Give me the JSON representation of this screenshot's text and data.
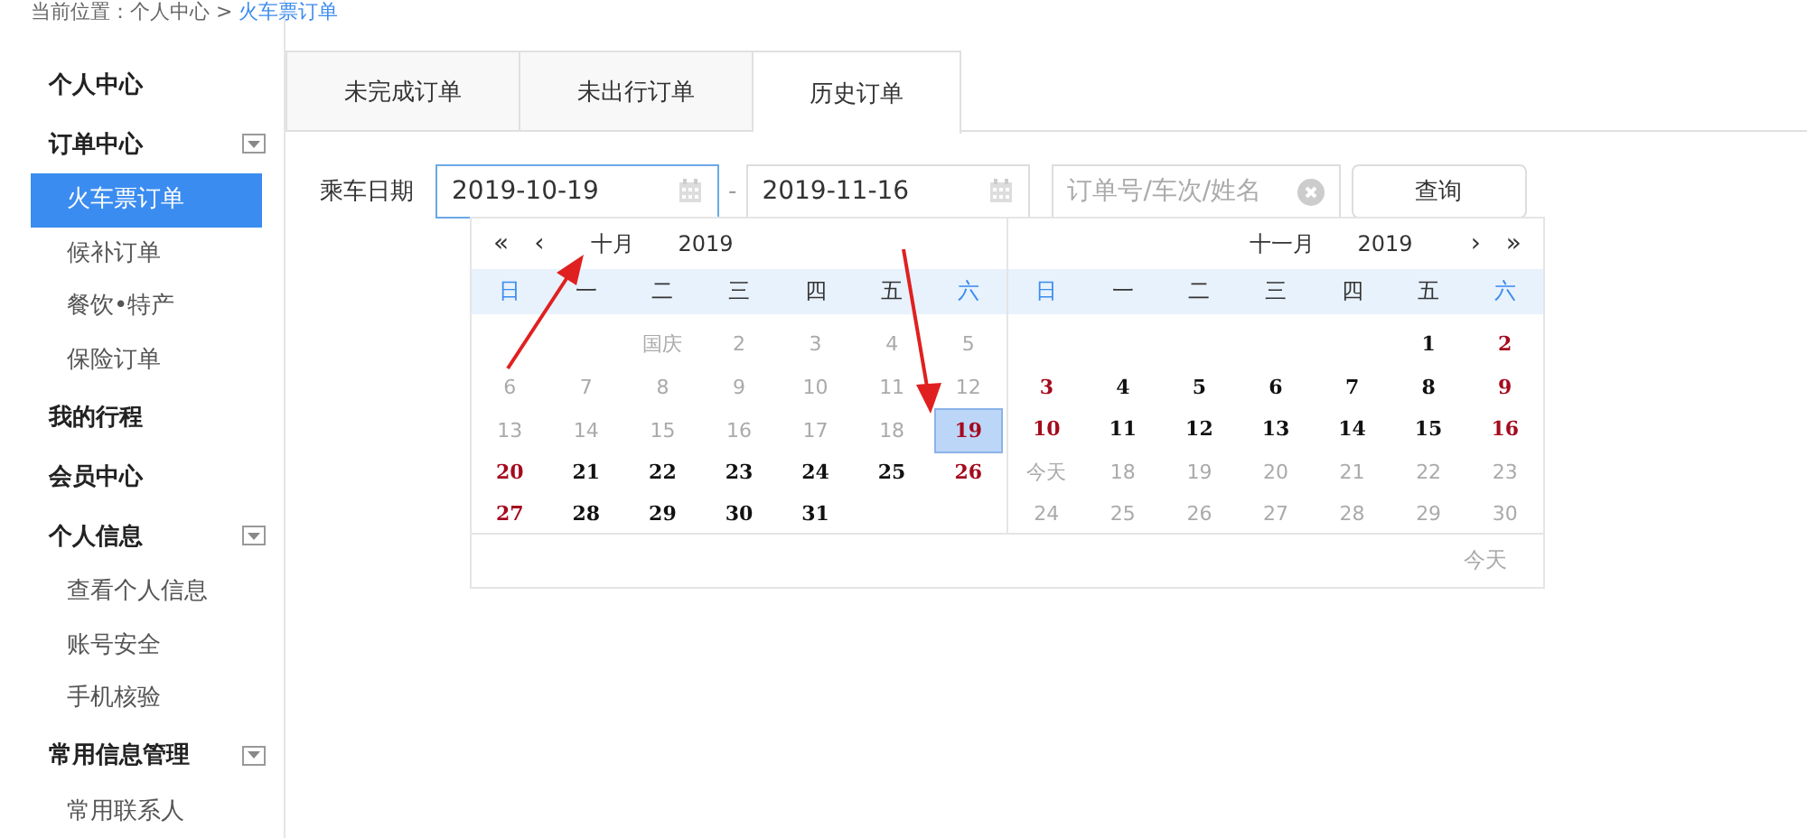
{
  "breadcrumb": {
    "prefix": "当前位置：个人中心 > ",
    "current": "火车票订单"
  },
  "sidebar": {
    "groups": [
      {
        "label": "个人中心",
        "collapsible": false
      },
      {
        "label": "订单中心",
        "collapsible": true,
        "items": [
          {
            "label": "火车票订单",
            "selected": true
          },
          {
            "label": "候补订单",
            "selected": false
          },
          {
            "label": "餐饮•特产",
            "selected": false
          },
          {
            "label": "保险订单",
            "selected": false
          }
        ]
      },
      {
        "label": "我的行程",
        "collapsible": false
      },
      {
        "label": "会员中心",
        "collapsible": false
      },
      {
        "label": "个人信息",
        "collapsible": true,
        "items": [
          {
            "label": "查看个人信息",
            "selected": false
          },
          {
            "label": "账号安全",
            "selected": false
          },
          {
            "label": "手机核验",
            "selected": false
          }
        ]
      },
      {
        "label": "常用信息管理",
        "collapsible": true,
        "items": [
          {
            "label": "常用联系人",
            "selected": false
          }
        ]
      }
    ]
  },
  "tabs": [
    {
      "label": "未完成订单",
      "selected": false
    },
    {
      "label": "未出行订单",
      "selected": false
    },
    {
      "label": "历史订单",
      "selected": true
    }
  ],
  "filter": {
    "label": "乘车日期",
    "start": "2019-10-19",
    "separator": "-",
    "end": "2019-11-16",
    "search_placeholder": "订单号/车次/姓名",
    "button": "查询"
  },
  "calendar": {
    "today_button": "今天",
    "months": [
      {
        "prev_year": "«",
        "prev_month": "‹",
        "month": "十月",
        "year": "2019",
        "weekdays": [
          {
            "label": "日",
            "weekend": true
          },
          {
            "label": "一",
            "weekend": false
          },
          {
            "label": "二",
            "weekend": false
          },
          {
            "label": "三",
            "weekend": false
          },
          {
            "label": "四",
            "weekend": false
          },
          {
            "label": "五",
            "weekend": false
          },
          {
            "label": "六",
            "weekend": true
          }
        ],
        "weeks": [
          [
            {
              "kind": "blank"
            },
            {
              "kind": "blank"
            },
            {
              "label": "国庆",
              "kind": "muted",
              "selected": false
            },
            {
              "label": "2",
              "kind": "muted",
              "selected": false
            },
            {
              "label": "3",
              "kind": "muted",
              "selected": false
            },
            {
              "label": "4",
              "kind": "muted",
              "selected": false
            },
            {
              "label": "5",
              "kind": "muted",
              "selected": false
            }
          ],
          [
            {
              "label": "6",
              "kind": "muted",
              "selected": false
            },
            {
              "label": "7",
              "kind": "muted",
              "selected": false
            },
            {
              "label": "8",
              "kind": "muted",
              "selected": false
            },
            {
              "label": "9",
              "kind": "muted",
              "selected": false
            },
            {
              "label": "10",
              "kind": "muted",
              "selected": false
            },
            {
              "label": "11",
              "kind": "muted",
              "selected": false
            },
            {
              "label": "12",
              "kind": "muted",
              "selected": false
            }
          ],
          [
            {
              "label": "13",
              "kind": "muted",
              "selected": false
            },
            {
              "label": "14",
              "kind": "muted",
              "selected": false
            },
            {
              "label": "15",
              "kind": "muted",
              "selected": false
            },
            {
              "label": "16",
              "kind": "muted",
              "selected": false
            },
            {
              "label": "17",
              "kind": "muted",
              "selected": false
            },
            {
              "label": "18",
              "kind": "muted",
              "selected": false
            },
            {
              "label": "19",
              "kind": "red",
              "selected": true
            }
          ],
          [
            {
              "label": "20",
              "kind": "red",
              "selected": false
            },
            {
              "label": "21",
              "kind": "normal",
              "selected": false
            },
            {
              "label": "22",
              "kind": "normal",
              "selected": false
            },
            {
              "label": "23",
              "kind": "normal",
              "selected": false
            },
            {
              "label": "24",
              "kind": "normal",
              "selected": false
            },
            {
              "label": "25",
              "kind": "normal",
              "selected": false
            },
            {
              "label": "26",
              "kind": "red",
              "selected": false
            }
          ],
          [
            {
              "label": "27",
              "kind": "red",
              "selected": false
            },
            {
              "label": "28",
              "kind": "normal",
              "selected": false
            },
            {
              "label": "29",
              "kind": "normal",
              "selected": false
            },
            {
              "label": "30",
              "kind": "normal",
              "selected": false
            },
            {
              "label": "31",
              "kind": "normal",
              "selected": false
            },
            {
              "kind": "blank"
            },
            {
              "kind": "blank"
            }
          ]
        ]
      },
      {
        "month": "十一月",
        "year": "2019",
        "next_month": "›",
        "next_year": "»",
        "weekdays": [
          {
            "label": "日",
            "weekend": true
          },
          {
            "label": "一",
            "weekend": false
          },
          {
            "label": "二",
            "weekend": false
          },
          {
            "label": "三",
            "weekend": false
          },
          {
            "label": "四",
            "weekend": false
          },
          {
            "label": "五",
            "weekend": false
          },
          {
            "label": "六",
            "weekend": true
          }
        ],
        "weeks": [
          [
            {
              "kind": "blank"
            },
            {
              "kind": "blank"
            },
            {
              "kind": "blank"
            },
            {
              "kind": "blank"
            },
            {
              "kind": "blank"
            },
            {
              "label": "1",
              "kind": "normal",
              "selected": false
            },
            {
              "label": "2",
              "kind": "red",
              "selected": false
            }
          ],
          [
            {
              "label": "3",
              "kind": "red",
              "selected": false
            },
            {
              "label": "4",
              "kind": "normal",
              "selected": false
            },
            {
              "label": "5",
              "kind": "normal",
              "selected": false
            },
            {
              "label": "6",
              "kind": "normal",
              "selected": false
            },
            {
              "label": "7",
              "kind": "normal",
              "selected": false
            },
            {
              "label": "8",
              "kind": "normal",
              "selected": false
            },
            {
              "label": "9",
              "kind": "red",
              "selected": false
            }
          ],
          [
            {
              "label": "10",
              "kind": "red",
              "selected": false
            },
            {
              "label": "11",
              "kind": "normal",
              "selected": false
            },
            {
              "label": "12",
              "kind": "normal",
              "selected": false
            },
            {
              "label": "13",
              "kind": "normal",
              "selected": false
            },
            {
              "label": "14",
              "kind": "normal",
              "selected": false
            },
            {
              "label": "15",
              "kind": "normal",
              "selected": false
            },
            {
              "label": "16",
              "kind": "red",
              "selected": false
            }
          ],
          [
            {
              "label": "今天",
              "kind": "muted",
              "selected": false
            },
            {
              "label": "18",
              "kind": "muted",
              "selected": false
            },
            {
              "label": "19",
              "kind": "muted",
              "selected": false
            },
            {
              "label": "20",
              "kind": "muted",
              "selected": false
            },
            {
              "label": "21",
              "kind": "muted",
              "selected": false
            },
            {
              "label": "22",
              "kind": "muted",
              "selected": false
            },
            {
              "label": "23",
              "kind": "muted",
              "selected": false
            }
          ],
          [
            {
              "label": "24",
              "kind": "muted",
              "selected": false
            },
            {
              "label": "25",
              "kind": "muted",
              "selected": false
            },
            {
              "label": "26",
              "kind": "muted",
              "selected": false
            },
            {
              "label": "27",
              "kind": "muted",
              "selected": false
            },
            {
              "label": "28",
              "kind": "muted",
              "selected": false
            },
            {
              "label": "29",
              "kind": "muted",
              "selected": false
            },
            {
              "label": "30",
              "kind": "muted",
              "selected": false
            }
          ]
        ]
      }
    ]
  }
}
